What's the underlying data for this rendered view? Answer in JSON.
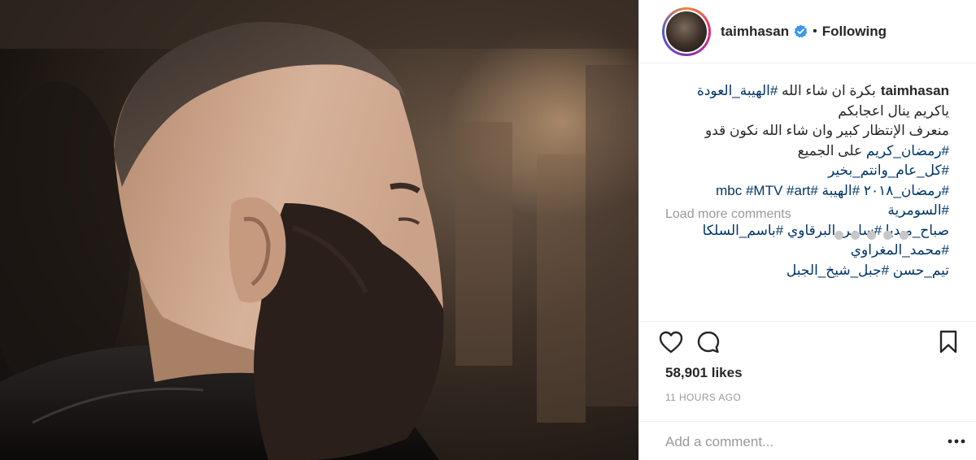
{
  "post": {
    "image_alt": "",
    "author": {
      "username": "taimhasan",
      "verified": true,
      "separator": "•",
      "follow_state": "Following"
    },
    "caption": {
      "owner": "taimhasan",
      "lines": [
        {
          "parts": [
            {
              "text": "بكرة ان شاء الله ",
              "tag": false
            },
            {
              "text": "#الهيبة_العودة",
              "tag": true
            }
          ]
        },
        {
          "parts": [
            {
              "text": "ياكريم ينال اعجابكم",
              "tag": false
            }
          ]
        },
        {
          "parts": [
            {
              "text": "منعرف الإنتظار كبير وان شاء الله نكون قدو",
              "tag": false
            }
          ]
        },
        {
          "parts": [
            {
              "text": "#رمضان_كريم",
              "tag": true
            },
            {
              "text": " على الجميع",
              "tag": false
            }
          ]
        },
        {
          "parts": [
            {
              "text": "#كل_عام_وانتم_بخير",
              "tag": true
            }
          ]
        },
        {
          "parts": [
            {
              "text": "#رمضان_٢٠١٨ ",
              "tag": true
            },
            {
              "text": "#الهيبة ",
              "tag": true
            },
            {
              "text": "#mbc ",
              "tag": true
            },
            {
              "text": "#MTV ",
              "tag": true
            },
            {
              "text": "#art",
              "tag": true
            }
          ]
        },
        {
          "parts": [
            {
              "text": "#السومرية",
              "tag": true
            }
          ]
        },
        {
          "parts": [
            {
              "text": "صباح_ميديا ",
              "tag": true
            },
            {
              "text": "#سامر_البرقاوي ",
              "tag": true
            },
            {
              "text": "#باسم_السلكا",
              "tag": true
            }
          ]
        },
        {
          "parts": [
            {
              "text": "#محمد_المغراوي",
              "tag": true
            }
          ]
        },
        {
          "parts": [
            {
              "text": "تيم_حسن ",
              "tag": true
            },
            {
              "text": "#جبل_شيخ_الجبل",
              "tag": true
            }
          ]
        }
      ]
    },
    "load_more_label": "Load more comments",
    "likes_label": "58,901 likes",
    "time_label": "11 HOURS AGO",
    "add_comment": {
      "placeholder": "Add a comment..."
    },
    "colors": {
      "hashtag": "#003569",
      "secondary_text": "#999999",
      "verified_badge": "#3897f0"
    },
    "icons": {
      "like": "heart-icon",
      "comment": "comment-bubble-icon",
      "save": "bookmark-icon",
      "more": "more-options-icon",
      "verified": "verified-badge-icon"
    }
  }
}
